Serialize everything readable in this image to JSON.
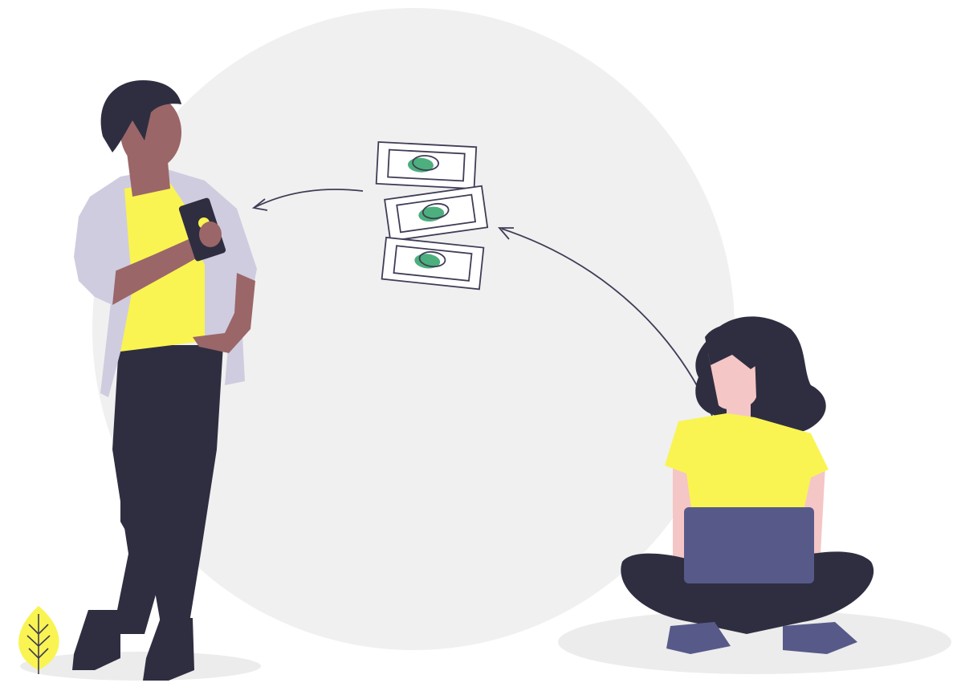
{
  "illustration": {
    "colors": {
      "backdrop": "#f0f0f0",
      "ground_shadow": "#ececec",
      "skin_dark": "#9b6668",
      "skin_light": "#f5c6c6",
      "hair": "#2f2e41",
      "shirt": "#f9f452",
      "jacket": "#cfcce0",
      "pants": "#2f2e41",
      "shoes": "#2f2e41",
      "laptop": "#575a89",
      "woman_shoes": "#575a89",
      "bill_stroke": "#3f3d56",
      "bill_dot": "#4caf7d",
      "plant": "#f9f452",
      "arrow": "#3f3d56"
    },
    "icons": [
      "money-bills-icon",
      "smartphone-icon",
      "laptop-icon",
      "plant-icon",
      "transfer-arrow-icon"
    ]
  }
}
